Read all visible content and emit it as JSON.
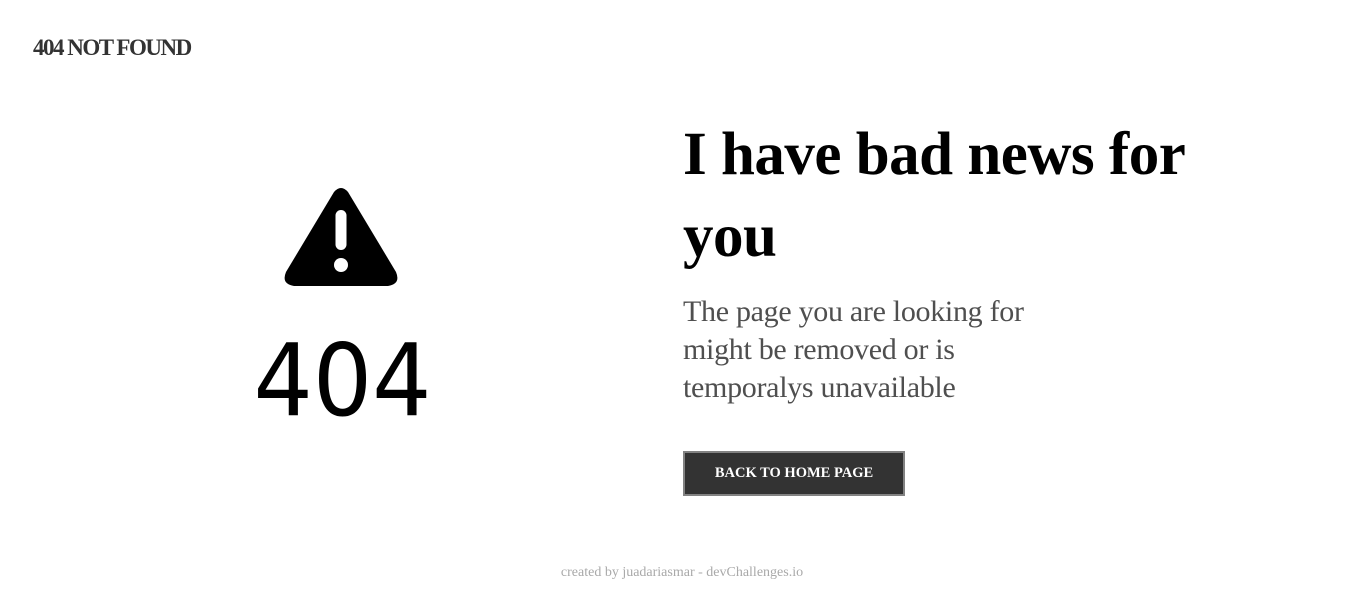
{
  "brand": {
    "title": "404 NOT FOUND"
  },
  "illustration": {
    "icon": "warning-triangle-icon",
    "code": "404"
  },
  "content": {
    "headline": "I have bad news for you",
    "message": "The page you are looking for might be removed or is temporalys unavailable",
    "button_label": "BACK TO HOME PAGE"
  },
  "footer": {
    "credit": "created by juadariasmar - devChallenges.io"
  },
  "colors": {
    "background": "#ffffff",
    "text": "#000000",
    "brand_text": "#333333",
    "message_text": "#4f4f4f",
    "button_background": "#333333",
    "button_border": "#828282",
    "footer_text": "#a9a9a9"
  }
}
